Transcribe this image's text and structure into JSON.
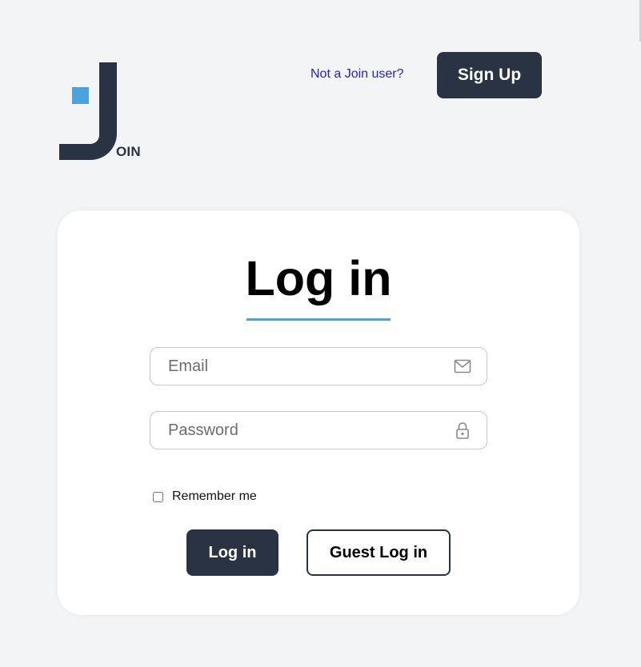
{
  "header": {
    "logo_icon": "join-logo-icon",
    "logo_text": "OIN",
    "not_user_text": "Not a Join user?",
    "signup_label": "Sign Up"
  },
  "login_card": {
    "title": "Log in",
    "email_placeholder": "Email",
    "email_value": "",
    "email_icon": "envelope-icon",
    "password_placeholder": "Password",
    "password_value": "",
    "password_icon": "lock-icon",
    "remember_label": "Remember me",
    "remember_checked": false,
    "login_label": "Log in",
    "guest_login_label": "Guest Log in"
  },
  "colors": {
    "background": "#f3f4f6",
    "primary_dark": "#2a3344",
    "accent_blue": "#4aa3dc",
    "link": "#2323c7",
    "card": "#ffffff"
  }
}
